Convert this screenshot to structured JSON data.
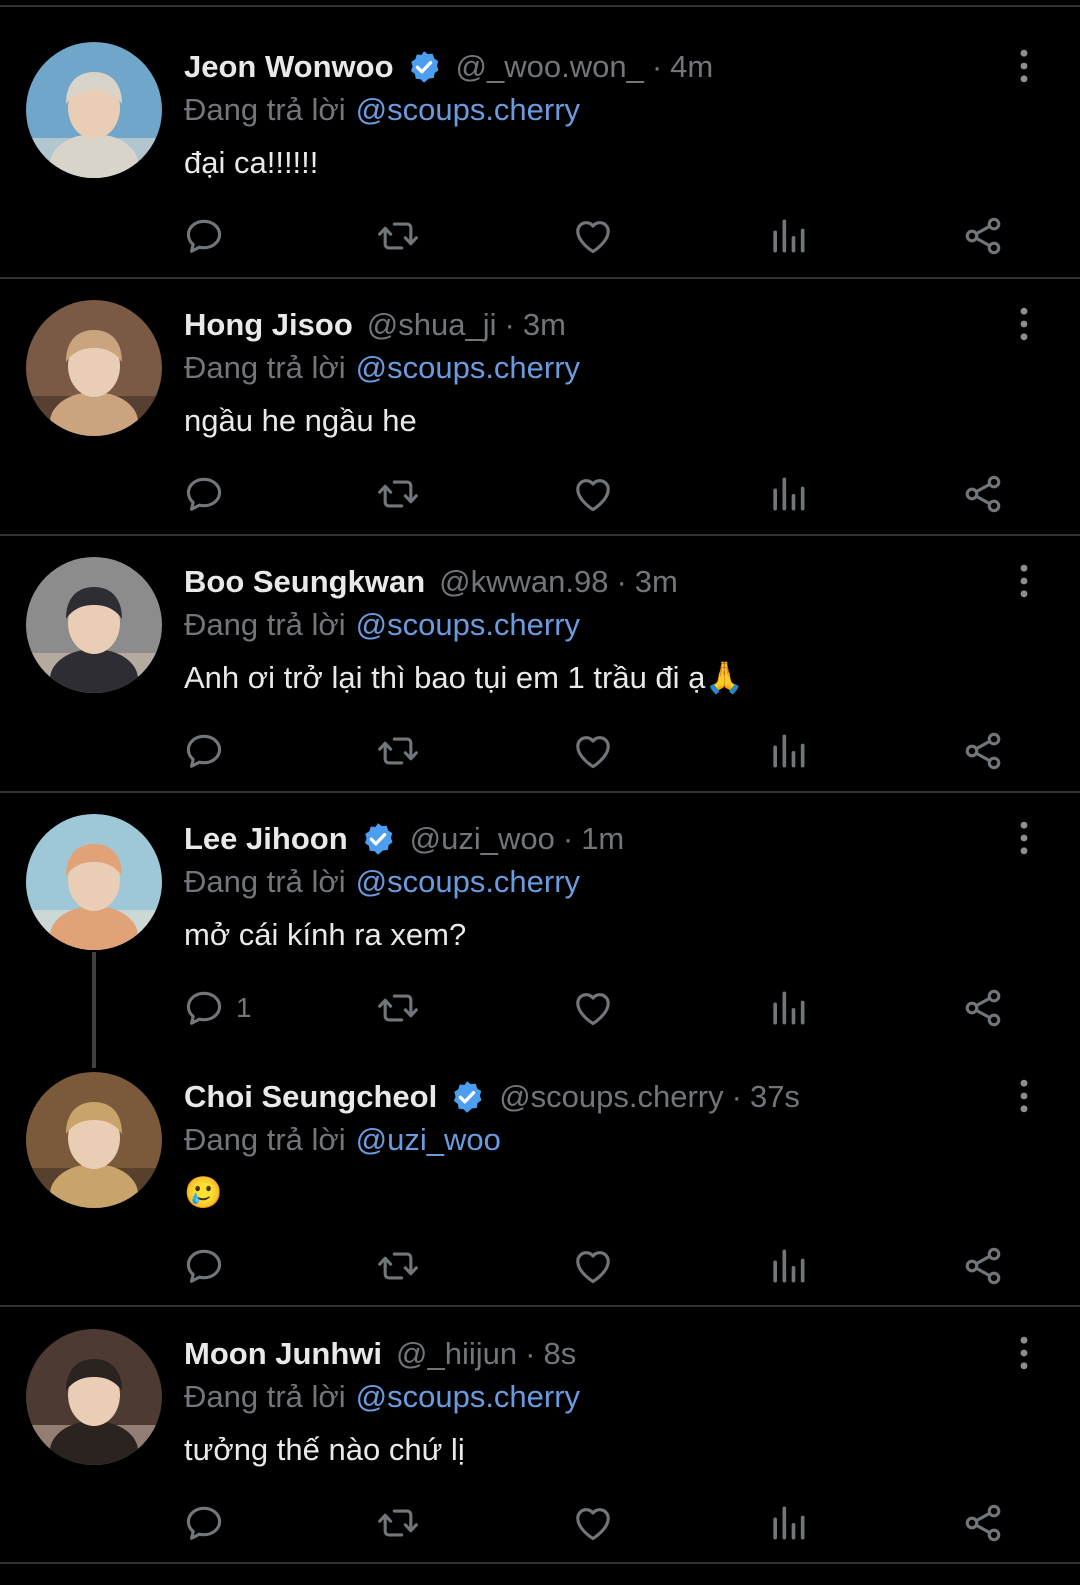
{
  "reply_prefix": "Đang trả lời",
  "colors": {
    "background": "#000000",
    "text": "#e7e9ea",
    "muted": "#71767b",
    "link": "#6b9bdf",
    "verified": "#4c9ff0",
    "divider": "#2f3336"
  },
  "tweets": [
    {
      "name": "Jeon Wonwoo",
      "verified": true,
      "handle": "@_woo.won_",
      "separator": "·",
      "time": "4m",
      "reply_to": "@scoups.cherry",
      "text": "đại ca!!!!!!",
      "reply_count": ""
    },
    {
      "name": "Hong Jisoo",
      "verified": false,
      "handle": "@shua_ji",
      "separator": "·",
      "time": "3m",
      "reply_to": "@scoups.cherry",
      "text": "ngầu he ngầu he",
      "reply_count": ""
    },
    {
      "name": "Boo Seungkwan",
      "verified": false,
      "handle": "@kwwan.98",
      "separator": "·",
      "time": "3m",
      "reply_to": "@scoups.cherry",
      "text": "Anh ơi trở lại thì bao tụi em 1 trầu đi ạ🙏",
      "reply_count": ""
    },
    {
      "name": "Lee Jihoon",
      "verified": true,
      "handle": "@uzi_woo",
      "separator": "·",
      "time": "1m",
      "reply_to": "@scoups.cherry",
      "text": "mở cái kính ra xem?",
      "reply_count": "1"
    },
    {
      "name": "Choi Seungcheol",
      "verified": true,
      "handle": "@scoups.cherry",
      "separator": "·",
      "time": "37s",
      "reply_to": "@uzi_woo",
      "text": "🥲",
      "reply_count": ""
    },
    {
      "name": "Moon Junhwi",
      "verified": false,
      "handle": "@_hiijun",
      "separator": "·",
      "time": "8s",
      "reply_to": "@scoups.cherry",
      "text": "tưởng thế nào chứ lị",
      "reply_count": ""
    }
  ]
}
